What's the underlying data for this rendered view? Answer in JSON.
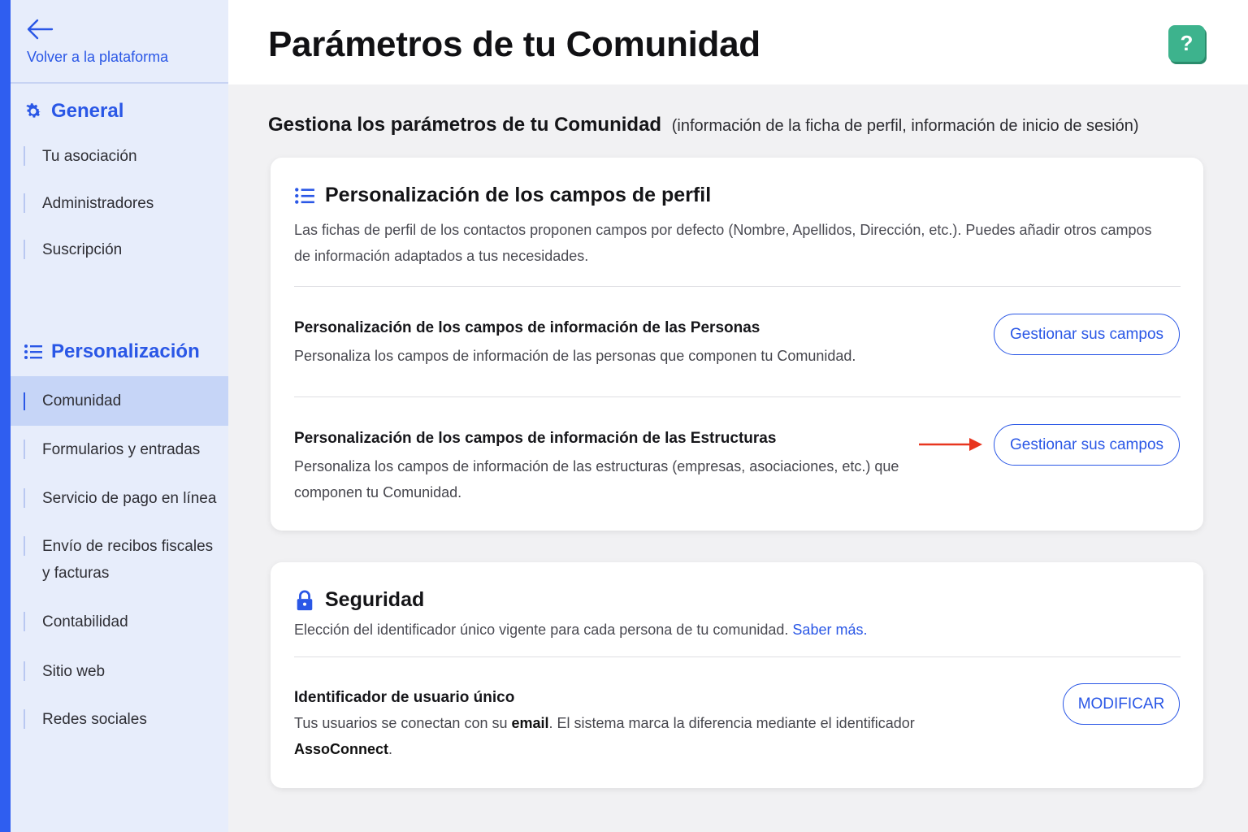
{
  "sidebar": {
    "back_label": "Volver a la plataforma",
    "general": {
      "title": "General",
      "items": [
        "Tu asociación",
        "Administradores",
        "Suscripción"
      ]
    },
    "personalizacion": {
      "title": "Personalización",
      "items": [
        "Comunidad",
        "Formularios y entradas",
        "Servicio de pago en línea",
        "Envío de recibos fiscales y facturas",
        "Contabilidad",
        "Sitio web",
        "Redes sociales"
      ],
      "active": "Comunidad"
    }
  },
  "header": {
    "title": "Parámetros de tu Comunidad",
    "help_label": "?"
  },
  "subtitle": {
    "main": "Gestiona los parámetros de tu Comunidad",
    "note": "(información de la ficha de perfil, información de inicio de sesión)"
  },
  "profile_card": {
    "title": "Personalización de los campos de perfil",
    "description": "Las fichas de perfil de los contactos proponen campos por defecto (Nombre, Apellidos, Dirección, etc.). Puedes añadir otros campos de información adaptados a tus necesidades.",
    "rows": [
      {
        "title": "Personalización de los campos de información de las Personas",
        "description": "Personaliza los campos de información de las personas que componen tu Comunidad.",
        "button": "Gestionar sus campos"
      },
      {
        "title": "Personalización de los campos de información de las Estructuras",
        "description": "Personaliza los campos de información de las estructuras (empresas, asociaciones, etc.) que componen tu Comunidad.",
        "button": "Gestionar sus campos"
      }
    ]
  },
  "security_card": {
    "title": "Seguridad",
    "description": "Elección del identificador único vigente para cada persona de tu comunidad.",
    "link": "Saber más.",
    "row": {
      "title": "Identificador de usuario único",
      "desc_part1": "Tus usuarios se conectan con su",
      "desc_bold1": "email",
      "desc_part2": ". El sistema marca la diferencia mediante el identificador",
      "desc_bold2": "AssoConnect",
      "desc_part3": ".",
      "button": "MODIFICAR"
    }
  },
  "colors": {
    "accent": "#2a57e6",
    "sidebar_bg": "#e7edfb",
    "sidebar_stripe": "#2f5ef0",
    "active_item_bg": "#c6d5f7",
    "help_button": "#3db38d",
    "annotation_arrow": "#e8351f"
  }
}
